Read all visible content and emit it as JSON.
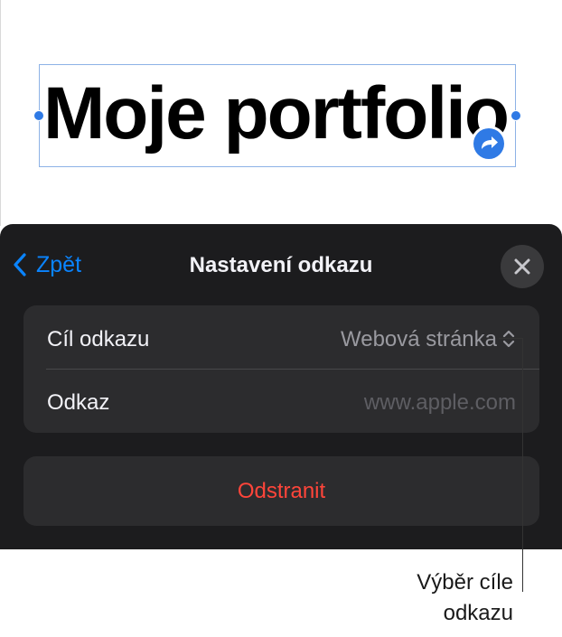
{
  "canvas": {
    "title_text": "Moje portfolio"
  },
  "panel": {
    "back_label": "Zpět",
    "title": "Nastavení odkazu",
    "link_destination_label": "Cíl odkazu",
    "link_destination_value": "Webová stránka",
    "link_label": "Odkaz",
    "link_placeholder": "www.apple.com",
    "remove_label": "Odstranit"
  },
  "callout": {
    "line1": "Výběr cíle",
    "line2": "odkazu"
  },
  "colors": {
    "accent_blue": "#0a84ff",
    "destructive_red": "#ff453a",
    "panel_background": "#1c1c1e",
    "group_background": "#2c2c2e",
    "selection_handle": "#2f7ae5"
  },
  "icons": {
    "back": "chevron-left-icon",
    "close": "close-icon",
    "link_badge": "link-arrow-icon",
    "popup": "chevron-up-down-icon"
  }
}
